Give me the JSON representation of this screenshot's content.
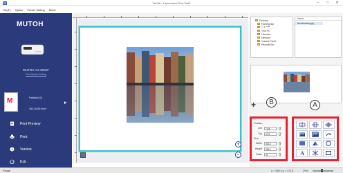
{
  "window": {
    "title": "VerUtil - Layout and Print Tool2"
  },
  "menu": {
    "items": [
      "File(F)",
      "Option",
      "Printer Setting",
      "Mode"
    ]
  },
  "sidebar": {
    "logo": "MUTOH",
    "printer_name": "MUTOH VJ-426UF",
    "printer_setting_link": "Print Media Setting",
    "media": {
      "letter": "M",
      "name": "Failsafe(A3)",
      "size": "483.2x329.6mm"
    },
    "nav": [
      {
        "label": "Print Preview",
        "icon": "print-preview-icon"
      },
      {
        "label": "Print",
        "icon": "printer-icon"
      },
      {
        "label": "Version",
        "icon": "info-icon"
      },
      {
        "label": "Exit",
        "icon": "power-icon"
      }
    ]
  },
  "tree": {
    "items": [
      "Desktop",
      "Homegroup",
      "1ユーザ",
      "This PC",
      "Libraries",
      "Network",
      "Control Panel",
      "Recycle Bin"
    ]
  },
  "filelist": {
    "header": "Name",
    "selected_file": "Amsterdam.jpg"
  },
  "properties": {
    "position_label": "Position",
    "left_label": "Left",
    "left_value": "74.8",
    "top_label": "Top",
    "top_value": "57.8",
    "size_label": "Size",
    "width_label": "Width",
    "width_value": "300.2",
    "height_label": "Height",
    "height_value": "205.2",
    "scale_label": "Scale",
    "scale_value": "91"
  },
  "callouts": {
    "a": "A",
    "b": "B"
  },
  "status": {
    "left": "Ready",
    "coords": "x = 496.4,y = 172.4",
    "zoom": "20%"
  },
  "colors": {
    "sidebar_bg": "#2a3a7a",
    "highlight_red": "#e81f2e",
    "media_border": "#39c0c9"
  }
}
